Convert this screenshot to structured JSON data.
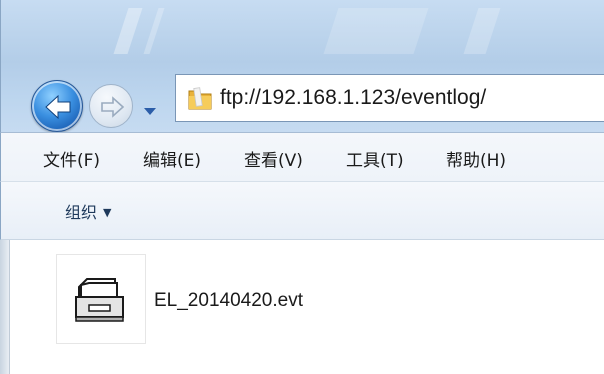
{
  "address": {
    "url": "ftp://192.168.1.123/eventlog/"
  },
  "navigation": {
    "back_icon": "back-arrow-icon",
    "forward_icon": "forward-arrow-icon",
    "history_icon": "chevron-down-icon"
  },
  "menu": {
    "items": [
      {
        "label": "文件(F)"
      },
      {
        "label": "编辑(E)"
      },
      {
        "label": "查看(V)"
      },
      {
        "label": "工具(T)"
      },
      {
        "label": "帮助(H)"
      }
    ]
  },
  "toolbar": {
    "organize_label": "组织",
    "organize_arrow": "▼"
  },
  "files": [
    {
      "name": "EL_20140420.evt",
      "icon": "file-icon"
    }
  ],
  "colors": {
    "glass": "#bcd4ec",
    "back_button": "#3a8fe0",
    "toolbar_text": "#1e395b"
  }
}
